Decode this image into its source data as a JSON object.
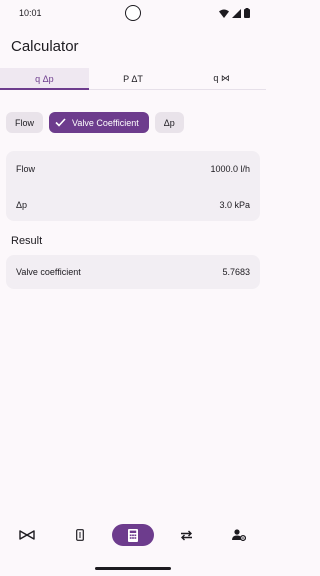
{
  "status_bar": {
    "time": "10:01"
  },
  "app": {
    "title": "Calculator"
  },
  "tabs": [
    {
      "label": "q Δp",
      "active": true
    },
    {
      "label": "P ΔT",
      "active": false
    },
    {
      "label": "q ⋈",
      "active": false
    }
  ],
  "chips": [
    {
      "label": "Flow",
      "selected": false
    },
    {
      "label": "Valve Coefficient",
      "selected": true
    },
    {
      "label": "Δp",
      "selected": false
    }
  ],
  "inputs": [
    {
      "label": "Flow",
      "value": "1000.0 l/h"
    },
    {
      "label": "Δp",
      "value": "3.0 kPa"
    }
  ],
  "result": {
    "title": "Result",
    "label": "Valve coefficient",
    "value": "5.7683"
  },
  "bottom_nav": [
    {
      "icon": "valve-icon",
      "active": false
    },
    {
      "icon": "radiator-icon",
      "active": false
    },
    {
      "icon": "calculator-icon",
      "active": true
    },
    {
      "icon": "swap-icon",
      "active": false
    },
    {
      "icon": "user-settings-icon",
      "active": false
    }
  ],
  "colors": {
    "accent": "#6d3c8d",
    "background": "#fcf8fb",
    "card": "#f2eef3"
  }
}
